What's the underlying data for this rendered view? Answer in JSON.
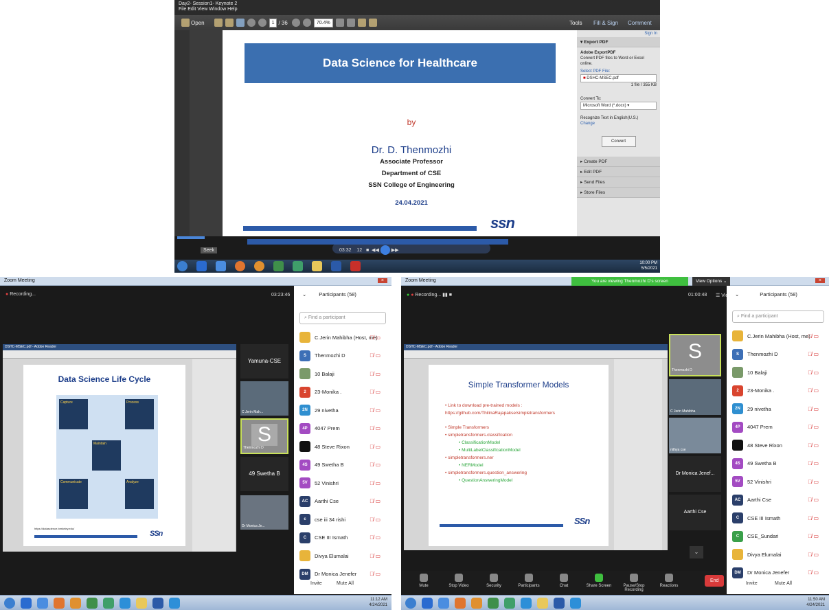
{
  "top": {
    "title": "Day2- Session1- Keynote 2",
    "menu": "File  Edit  View  Window  Help",
    "toolbar": {
      "open": "Open",
      "page": "1",
      "page_total": "/ 36",
      "zoom": "70.4%",
      "tools": "Tools",
      "fill_sign": "Fill & Sign",
      "comment": "Comment"
    },
    "slide": {
      "title": "Data Science for Healthcare",
      "by": "by",
      "author": "Dr. D. Thenmozhi",
      "role": "Associate Professor",
      "dept": "Department of CSE",
      "college": "SSN College of Engineering",
      "date": "24.04.2021",
      "logo": "ssn"
    },
    "panel": {
      "sign_in": "Sign In",
      "export": "Export PDF",
      "adobe": "Adobe ExportPDF",
      "desc": "Convert PDF files to Word or Excel online.",
      "select": "Select PDF File:",
      "file": "DSHC-MSEC.pdf",
      "count": "1 file / 355 KB",
      "convert_to": "Convert To:",
      "format": "Microsoft Word (*.docx)",
      "recognize": "Recognize Text in English(U.S.)",
      "change": "Change",
      "convert_btn": "Convert",
      "create": "Create PDF",
      "edit": "Edit PDF",
      "send": "Send Files",
      "store": "Store Files"
    },
    "player": {
      "seek": "Seek",
      "time1": "03:32",
      "time2": "12"
    },
    "clock": {
      "time": "10:00 PM",
      "date": "5/5/2021"
    }
  },
  "left": {
    "title": "Zoom Meeting",
    "recording": "Recording...",
    "timer": "03:23:46",
    "participants_header": "Participants (58)",
    "search": "Find a participant",
    "slide_title": "Data Science Life Cycle",
    "slide_url": "https://datascience.berkeley.edu/",
    "pdf_title": "DSHC-MSEC.pdf - Adobe Reader",
    "thumb_name1": "Yamuna-CSE",
    "thumb_name2": "C Jerin Mah...",
    "thumb_name3": "Thenmozhi D",
    "thumb_name4": "49 Swetha B",
    "thumb_name5": "Dr Monica Je...",
    "cycle": {
      "capture": "Capture",
      "process": "Process",
      "maintain": "Maintain",
      "communicate": "Communicate",
      "analyze": "Analyze"
    },
    "invite": "Invite",
    "mute_all": "Mute All",
    "clock": {
      "time": "11:12 AM",
      "date": "4/24/2021"
    }
  },
  "right": {
    "title": "Zoom Meeting",
    "viewing": "You are viewing Thenmozhi D's screen",
    "view_options": "View Options",
    "recording": "Recording...",
    "timer": "01:00:48",
    "view": "View",
    "participants_header": "Participants (58)",
    "search": "Find a participant",
    "slide_title": "Simple Transformer Models",
    "bullets": [
      "Link to download pre-trained models : https://github.com/ThilinaRajapakse/simpletransformers",
      "Simple Transformers",
      "simpletransformers.classification",
      "ClassificationModel",
      "MultiLabelClassificationModel",
      "simpletransformers.ner",
      "NERModel",
      "simpletransformers.question_answering",
      "QuestionAnsweringModel"
    ],
    "thumb_name1": "Thenmozhi D",
    "thumb_name2": "C Jerin Mahibha",
    "thumb_name3": "nithya cse",
    "thumb_name4": "Dr Monica Jenef...",
    "thumb_name5": "Aarthi Cse",
    "toolbar": [
      "Mute",
      "Stop Video",
      "Security",
      "Participants",
      "Chat",
      "Share Screen",
      "Pause/Stop Recording",
      "Reactions"
    ],
    "participants_count": "58",
    "end": "End",
    "invite": "Invite",
    "mute_all": "Mute All",
    "clock": {
      "time": "11:50 AM",
      "date": "4/24/2021"
    }
  },
  "participants_left": [
    {
      "init": "",
      "name": "C.Jerin Mahibha (Host, me)",
      "color": "#e8b43a"
    },
    {
      "init": "S",
      "name": "Thenmozhi D",
      "color": "#3d6fb6"
    },
    {
      "init": "",
      "name": "10 Balaji",
      "color": "#7a9a6a"
    },
    {
      "init": "2",
      "name": "23-Monika .",
      "color": "#d9452f"
    },
    {
      "init": "2N",
      "name": "29 nivetha",
      "color": "#2f8fd0"
    },
    {
      "init": "4P",
      "name": "4047 Prem",
      "color": "#a34bc2"
    },
    {
      "init": "",
      "name": "48 Steve Rixon",
      "color": "#111111"
    },
    {
      "init": "4S",
      "name": "49 Swetha B",
      "color": "#a34bc2"
    },
    {
      "init": "5V",
      "name": "52 Vinishri",
      "color": "#a34bc2"
    },
    {
      "init": "AC",
      "name": "Aarthi Cse",
      "color": "#2b3f6a"
    },
    {
      "init": "c",
      "name": "cse iii 34 rishi",
      "color": "#2b3f6a"
    },
    {
      "init": "C",
      "name": "CSE III Ismath",
      "color": "#2b3f6a"
    },
    {
      "init": "",
      "name": "Divya Elumalai",
      "color": "#e8b43a"
    },
    {
      "init": "DM",
      "name": "Dr Monica Jenefer",
      "color": "#2b3f6a"
    }
  ],
  "participants_right": [
    {
      "init": "",
      "name": "C.Jerin Mahibha (Host, me)",
      "color": "#e8b43a"
    },
    {
      "init": "S",
      "name": "Thenmozhi D",
      "color": "#3d6fb6"
    },
    {
      "init": "",
      "name": "10 Balaji",
      "color": "#7a9a6a"
    },
    {
      "init": "2",
      "name": "23-Monika .",
      "color": "#d9452f"
    },
    {
      "init": "2N",
      "name": "29 nivetha",
      "color": "#2f8fd0"
    },
    {
      "init": "4P",
      "name": "4047 Prem",
      "color": "#a34bc2"
    },
    {
      "init": "",
      "name": "48 Steve Rixon",
      "color": "#111111"
    },
    {
      "init": "4S",
      "name": "49 Swetha B",
      "color": "#a34bc2"
    },
    {
      "init": "5V",
      "name": "52 Vinishri",
      "color": "#a34bc2"
    },
    {
      "init": "AC",
      "name": "Aarthi Cse",
      "color": "#2b3f6a"
    },
    {
      "init": "C",
      "name": "CSE III Ismath",
      "color": "#2b3f6a"
    },
    {
      "init": "C",
      "name": "CSE_Sundari",
      "color": "#3aa04a"
    },
    {
      "init": "",
      "name": "Divya Elumalai",
      "color": "#e8b43a"
    },
    {
      "init": "DM",
      "name": "Dr Monica Jenefer",
      "color": "#2b3f6a"
    }
  ]
}
